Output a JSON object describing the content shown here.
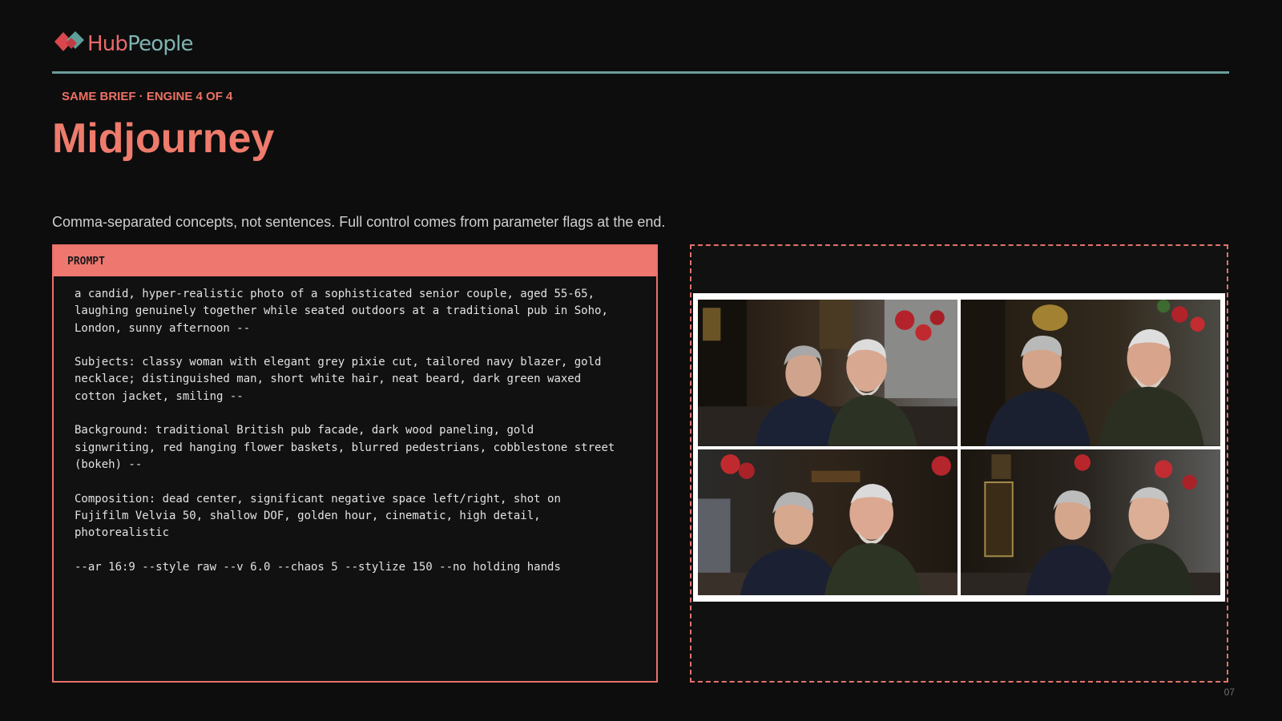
{
  "brand": {
    "name_part1": "Hub",
    "name_part2": "People",
    "colors": {
      "hub": "#e8686b",
      "people": "#7fb4b2",
      "rule": "#6a9e9b"
    }
  },
  "header": {
    "eyebrow": "SAME BRIEF · ENGINE 4 OF 4",
    "title": "Midjourney",
    "subtitle": "Comma-separated concepts, not sentences. Full control comes from parameter flags at the end."
  },
  "prompt": {
    "label": "PROMPT",
    "paragraphs": [
      "a candid, hyper-realistic photo of a sophisticated senior couple, aged 55-65,\nlaughing genuinely together while seated outdoors at a traditional pub in Soho,\nLondon, sunny afternoon --",
      "Subjects: classy woman with elegant grey pixie cut, tailored navy blazer, gold\nnecklace; distinguished man, short white hair, neat beard, dark green waxed\ncotton jacket, smiling --",
      "Background: traditional British pub facade, dark wood paneling, gold\nsignwriting, red hanging flower baskets, blurred pedestrians, cobblestone street\n(bokeh) --",
      "Composition: dead center, significant negative space left/right, shot on\nFujifilm Velvia 50, shallow DOF, golden hour, cinematic, high detail,\nphotorealistic",
      "--ar 16:9 --style raw --v 6.0 --chaos 5 --stylize 150 --no holding hands"
    ]
  },
  "images": {
    "accent": "#e4726a",
    "tiles": [
      {
        "sign_text": ""
      },
      {
        "sign_text": ""
      },
      {
        "sign_text": ""
      },
      {
        "sign_text": ""
      }
    ]
  },
  "footer": {
    "page_number": "07"
  }
}
